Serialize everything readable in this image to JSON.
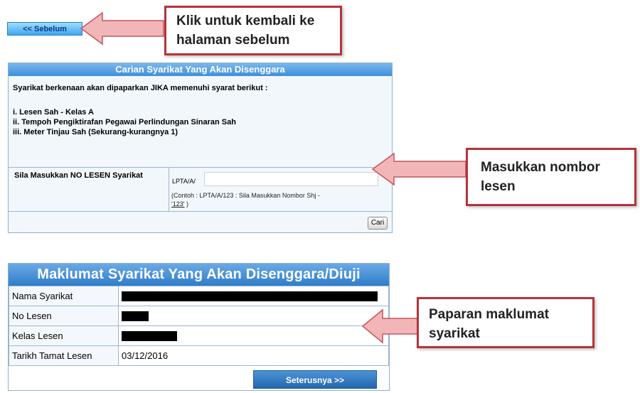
{
  "back_button": {
    "label": "<< Sebelum"
  },
  "callouts": {
    "back": {
      "line1": "Klik untuk kembali ke",
      "line2": "halaman sebelum"
    },
    "license": {
      "line1": "Masukkan nombor",
      "line2": "lesen"
    },
    "company": {
      "line1": "Paparan maklumat",
      "line2": "syarikat"
    }
  },
  "search_panel": {
    "title": "Carian Syarikat Yang Akan Disenggara",
    "intro": "Syarikat berkenaan akan dipaparkan JIKA memenuhi syarat berikut :",
    "conditions": [
      "i. Lesen Sah - Kelas A",
      "ii. Tempoh Pengiktirafan Pegawai Perlindungan Sinaran Sah",
      "iii. Meter Tinjau Sah (Sekurang-kurangnya 1)"
    ],
    "input_label": "Sila Masukkan NO LESEN Syarikat",
    "prefix": "LPTA/A/",
    "hint_line1": "(Contoh : LPTA/A/123 : Sila Masukkan Nombor Shj -",
    "hint_example": "'123'",
    "hint_close": " )",
    "search_button": "Cari"
  },
  "info_panel": {
    "title": "Maklumat Syarikat Yang Akan Disenggara/Diuji",
    "rows": [
      {
        "label": "Nama Syarikat",
        "value": ""
      },
      {
        "label": "No Lesen",
        "value": ""
      },
      {
        "label": "Kelas Lesen",
        "value": ""
      },
      {
        "label": "Tarikh Tamat Lesen",
        "value": "03/12/2016"
      }
    ],
    "next_button": "Seterusnya >>"
  },
  "colors": {
    "callout_border": "#b5333b",
    "arrow_fill": "#f2b6b9",
    "header_blue": "#3f8fdb"
  }
}
